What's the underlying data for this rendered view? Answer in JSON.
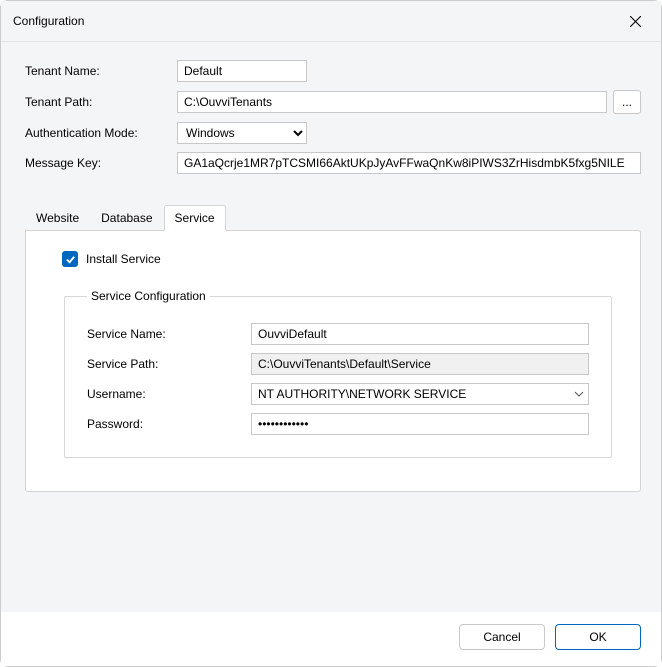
{
  "window": {
    "title": "Configuration"
  },
  "labels": {
    "tenant_name": "Tenant Name:",
    "tenant_path": "Tenant Path:",
    "auth_mode": "Authentication Mode:",
    "message_key": "Message Key:"
  },
  "values": {
    "tenant_name": "Default",
    "tenant_path": "C:\\OuvviTenants",
    "auth_mode": "Windows",
    "message_key": "GA1aQcrje1MR7pTCSMI66AktUKpJyAvFFwaQnKw8iPIWS3ZrHisdmbK5fxg5NILE"
  },
  "ellipsis": "...",
  "tabs": {
    "website": "Website",
    "database": "Database",
    "service": "Service"
  },
  "service_tab": {
    "install_label": "Install Service",
    "legend": "Service Configuration",
    "labels": {
      "service_name": "Service Name:",
      "service_path": "Service Path:",
      "username": "Username:",
      "password": "Password:"
    },
    "values": {
      "service_name": "OuvviDefault",
      "service_path": "C:\\OuvviTenants\\Default\\Service",
      "username": "NT AUTHORITY\\NETWORK SERVICE",
      "password": "••••••••••••"
    }
  },
  "buttons": {
    "cancel": "Cancel",
    "ok": "OK"
  }
}
